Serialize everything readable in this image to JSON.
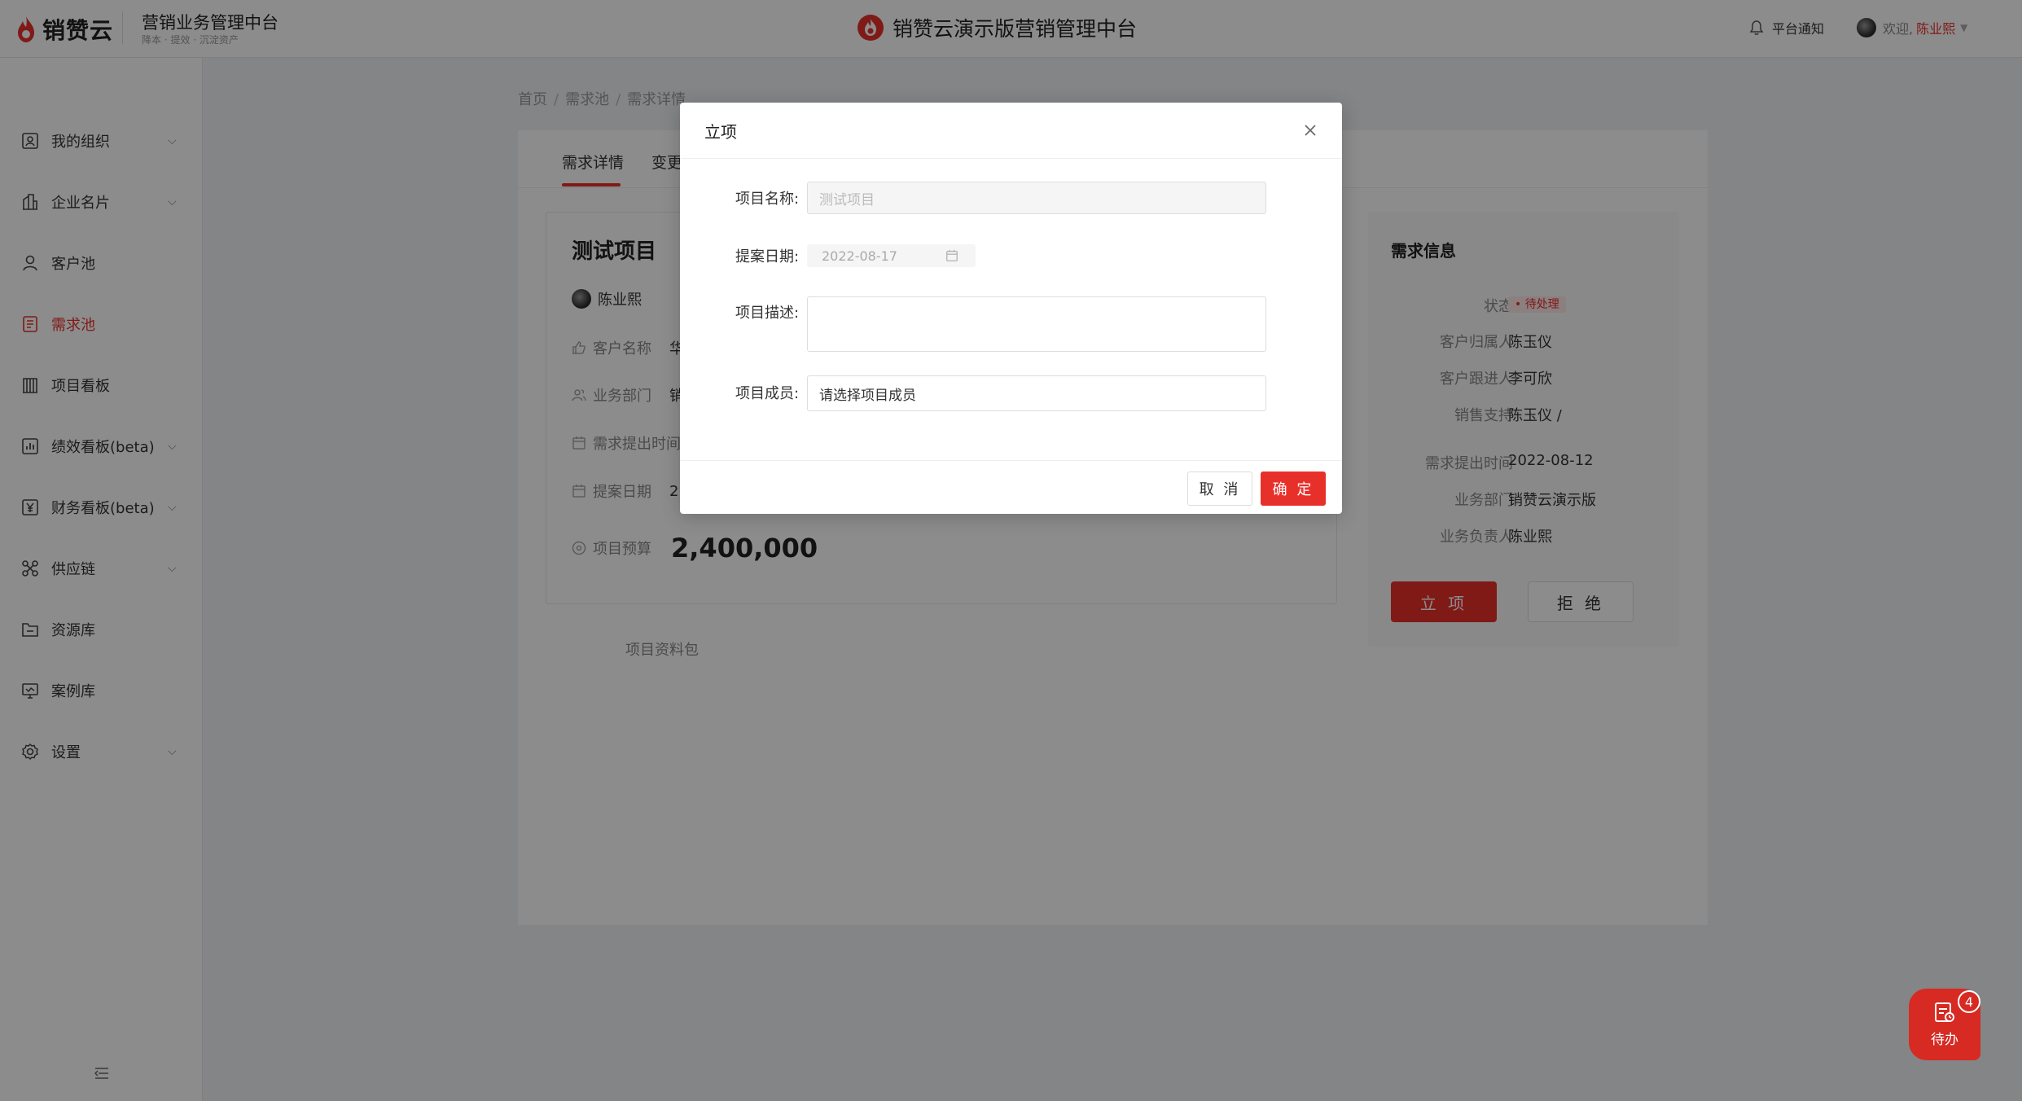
{
  "header": {
    "logo_text": "销赞云",
    "platform_title": "营销业务管理中台",
    "platform_subtitle": "降本 · 提效 · 沉淀资产",
    "center_title": "销赞云演示版营销管理中台",
    "notify_label": "平台通知",
    "welcome": "欢迎,",
    "username": "陈业熙"
  },
  "sidebar": {
    "items": [
      {
        "label": "我的组织",
        "icon": "org-icon",
        "chevron": true
      },
      {
        "label": "企业名片",
        "icon": "building-icon",
        "chevron": true
      },
      {
        "label": "客户池",
        "icon": "user-icon",
        "chevron": false
      },
      {
        "label": "需求池",
        "icon": "document-icon",
        "chevron": false,
        "active": true
      },
      {
        "label": "项目看板",
        "icon": "board-icon",
        "chevron": false
      },
      {
        "label": "绩效看板(beta)",
        "icon": "chart-icon",
        "chevron": true
      },
      {
        "label": "财务看板(beta)",
        "icon": "finance-icon",
        "chevron": true
      },
      {
        "label": "供应链",
        "icon": "supply-chain-icon",
        "chevron": true
      },
      {
        "label": "资源库",
        "icon": "folder-icon",
        "chevron": false
      },
      {
        "label": "案例库",
        "icon": "case-icon",
        "chevron": false
      },
      {
        "label": "设置",
        "icon": "gear-icon",
        "chevron": true
      }
    ]
  },
  "breadcrumb": [
    "首页",
    "需求池",
    "需求详情"
  ],
  "tabs": [
    "需求详情",
    "变更"
  ],
  "project": {
    "title": "测试项目",
    "owner": "陈业熙",
    "rows": [
      {
        "label": "客户名称",
        "value": "华"
      },
      {
        "label": "业务部门",
        "value": "销"
      },
      {
        "label": "需求提出时间",
        "value": ""
      },
      {
        "label": "提案日期",
        "value": "2"
      }
    ],
    "budget_label": "项目预算",
    "budget_value": "2,400,000",
    "file_pack": "项目资料包"
  },
  "info": {
    "title": "需求信息",
    "rows": [
      {
        "label": "状态",
        "value": "• 待处理",
        "badge": true
      },
      {
        "label": "客户归属人",
        "value": "陈玉仪"
      },
      {
        "label": "客户跟进人",
        "value": "李可欣"
      },
      {
        "label": "销售支持",
        "value": "陈玉仪 /"
      },
      {
        "label": "需求提出时间",
        "value": "2022-08-12"
      },
      {
        "label": "业务部门",
        "value": "销赞云演示版"
      },
      {
        "label": "业务负责人",
        "value": "陈业熙"
      }
    ],
    "approve_label": "立 项",
    "reject_label": "拒 绝"
  },
  "modal": {
    "title": "立项",
    "name_label": "项目名称:",
    "name_value": "测试项目",
    "date_label": "提案日期:",
    "date_value": "2022-08-17",
    "desc_label": "项目描述:",
    "member_label": "项目成员:",
    "member_placeholder": "请选择项目成员",
    "cancel_label": "取 消",
    "ok_label": "确 定"
  },
  "todo": {
    "label": "待办",
    "count": "4"
  },
  "colors": {
    "accent": "#e8302a"
  }
}
